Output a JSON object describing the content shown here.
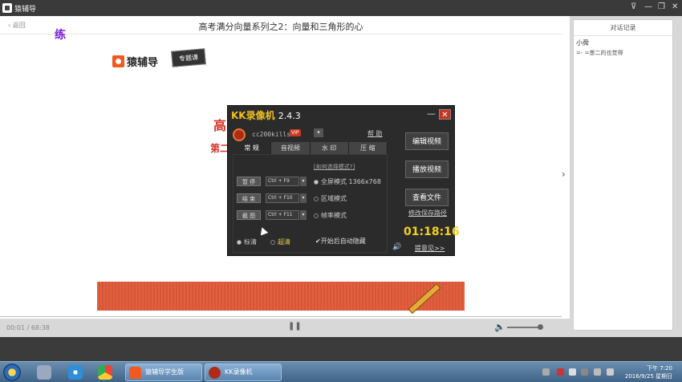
{
  "app": {
    "title": "猿辅导",
    "window_controls": [
      "⊽",
      "—",
      "❐",
      "✕"
    ]
  },
  "lesson": {
    "back_label": "返回",
    "title": "高考满分向量系列之2：向量和三角形的心",
    "purple_text": "练",
    "brand": "猿辅导",
    "tag": "专题课",
    "slide_line1": "高",
    "slide_line2": "第二"
  },
  "player": {
    "time": "00:01 / 68:38",
    "pause_icon": "❚❚",
    "volume_icon": "🔈",
    "expand": "›"
  },
  "chat": {
    "header": "对话记录",
    "user": "小舜",
    "message": "=- =墨二的也觉得"
  },
  "kk": {
    "title": "KK录像机",
    "version": "2.4.3",
    "min": "—",
    "close": "✕",
    "user": "cc200kills",
    "vip": "VIP",
    "dropdown": "▾",
    "help": "帮 助",
    "tabs": [
      "常 规",
      "音视频",
      "水 印",
      "压 缩"
    ],
    "select_link": "[如何选择模式?]",
    "actions": [
      {
        "label": "暂 停",
        "key": "Ctrl + F9"
      },
      {
        "label": "结 束",
        "key": "Ctrl + F10"
      },
      {
        "label": "截 图",
        "key": "Ctrl + F11"
      }
    ],
    "key_dd": "▾",
    "modes": [
      {
        "label": "全屏模式 1366x768",
        "on": true
      },
      {
        "label": "区域模式",
        "on": false
      },
      {
        "label": "帧率模式",
        "on": false
      }
    ],
    "quality": [
      {
        "label": "标清",
        "on": true
      },
      {
        "label": "超清",
        "on": false
      }
    ],
    "auto_hide": "开始后自动隐藏",
    "auto_hide_check": "✔",
    "side_buttons": [
      "编辑视频",
      "播放视频",
      "查看文件"
    ],
    "save_path": "修改保存路径",
    "timer": "01:18:16",
    "speaker": "🔊",
    "feedback": "提意见>>"
  },
  "taskbar": {
    "tasks": [
      "猿辅导学生版",
      "KK录像机 01:18:16"
    ],
    "clock_time": "下午 7:20",
    "clock_date": "2016/9/25 星期日"
  }
}
